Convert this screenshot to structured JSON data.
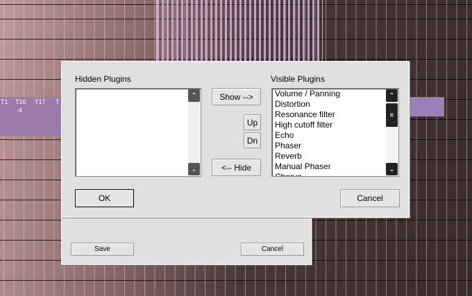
{
  "background": {
    "tracks": [
      "T1",
      "T16",
      "T17",
      "T"
    ],
    "track_value": "-4"
  },
  "dialog": {
    "hidden_label": "Hidden Plugins",
    "visible_label": "Visible Plugins",
    "hidden_items": [],
    "visible_items": [
      "Volume / Panning",
      "Distortion",
      "Resonance filter",
      "High cutoff filter",
      "Echo",
      "Phaser",
      "Reverb",
      "Manual Phaser",
      "Chorus"
    ],
    "show_button": "Show -->",
    "up_button": "Up",
    "dn_button": "Dn",
    "hide_button": "<-- Hide",
    "ok_button": "OK",
    "cancel_button": "Cancel"
  },
  "back_dialog": {
    "save_button": "Save",
    "cancel_button": "Cancel"
  }
}
